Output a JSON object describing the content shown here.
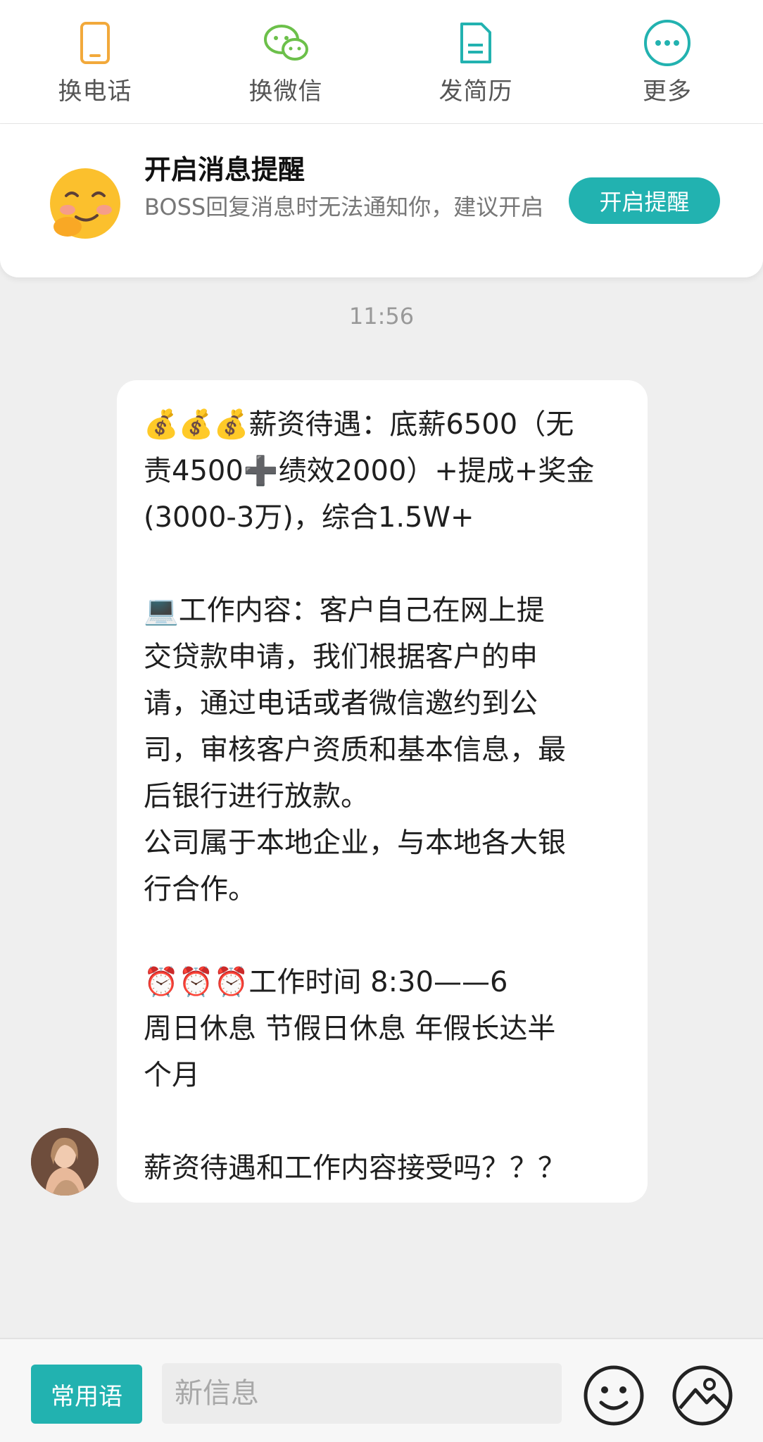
{
  "actions": [
    {
      "label": "换电话",
      "icon": "phone-icon",
      "color": "#f2a93b"
    },
    {
      "label": "换微信",
      "icon": "wechat-icon",
      "color": "#6cc04a"
    },
    {
      "label": "发简历",
      "icon": "resume-icon",
      "color": "#22b2b0"
    },
    {
      "label": "更多",
      "icon": "more-icon",
      "color": "#22b2b0"
    }
  ],
  "notice": {
    "title": "开启消息提醒",
    "desc": "BOSS回复消息时无法通知你，建议开启",
    "button": "开启提醒",
    "emoji_icon": "blushing-smile-icon"
  },
  "chat": {
    "time": "11:56",
    "message_lines": [
      "💰💰💰薪资待遇：底薪6500（无",
      "责4500➕绩效2000）+提成+奖金",
      "(3000-3万)，综合1.5W+",
      "",
      "💻工作内容：客户自己在网上提",
      "交贷款申请，我们根据客户的申",
      "请，通过电话或者微信邀约到公",
      "司，审核客户资质和基本信息，最",
      "后银行进行放款。",
      "公司属于本地企业，与本地各大银",
      "行合作。",
      "",
      "⏰⏰⏰工作时间 8:30——6",
      "周日休息 节假日休息 年假长达半",
      "个月",
      "",
      "薪资待遇和工作内容接受吗？？？"
    ]
  },
  "input": {
    "phrases_button": "常用语",
    "placeholder": "新信息",
    "emoji_tool_icon": "emoji-icon",
    "image_tool_icon": "image-icon"
  },
  "colors": {
    "accent": "#22b2b0",
    "background": "#efefef"
  }
}
